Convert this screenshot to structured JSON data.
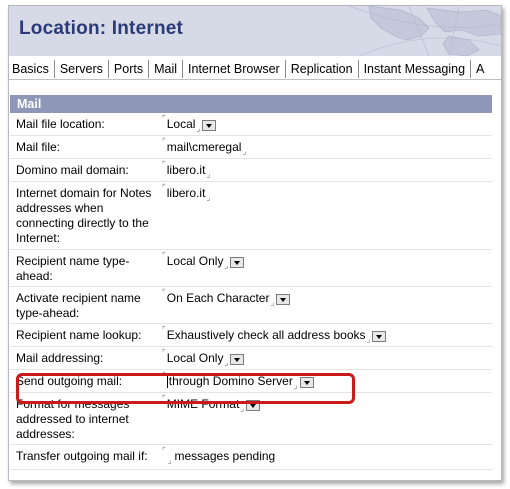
{
  "title": "Location: Internet",
  "tabs": [
    "Basics",
    "Servers",
    "Ports",
    "Mail",
    "Internet Browser",
    "Replication",
    "Instant Messaging",
    "A"
  ],
  "section": "Mail",
  "fields": [
    {
      "label": "Mail file location:",
      "value": "Local",
      "dropdown": true
    },
    {
      "label": "Mail file:",
      "value": "mail\\cmeregal",
      "dropdown": false
    },
    {
      "label": "Domino mail domain:",
      "value": "libero.it",
      "dropdown": false
    },
    {
      "label": "Internet domain for Notes addresses when connecting directly to the Internet:",
      "value": "libero.it",
      "dropdown": false
    },
    {
      "label": "Recipient name type-ahead:",
      "value": "Local Only",
      "dropdown": true
    },
    {
      "label": "Activate recipient name type-ahead:",
      "value": "On Each Character",
      "dropdown": true
    },
    {
      "label": "Recipient name lookup:",
      "value": "Exhaustively check all address books",
      "dropdown": true
    },
    {
      "label": "Mail addressing:",
      "value": "Local Only",
      "dropdown": true
    },
    {
      "label": "Send outgoing mail:",
      "value": "through Domino Server",
      "dropdown": true,
      "caret": true
    },
    {
      "label": "Format for messages addressed to internet addresses:",
      "value": "MIME Format",
      "dropdown": true
    },
    {
      "label": "Transfer outgoing mail if:",
      "value": "",
      "suffix": "messages pending",
      "dropdown": false
    }
  ],
  "highlight_color": "#cc1a1a",
  "header_color": "#8e97b8",
  "title_color": "#2b3a78"
}
